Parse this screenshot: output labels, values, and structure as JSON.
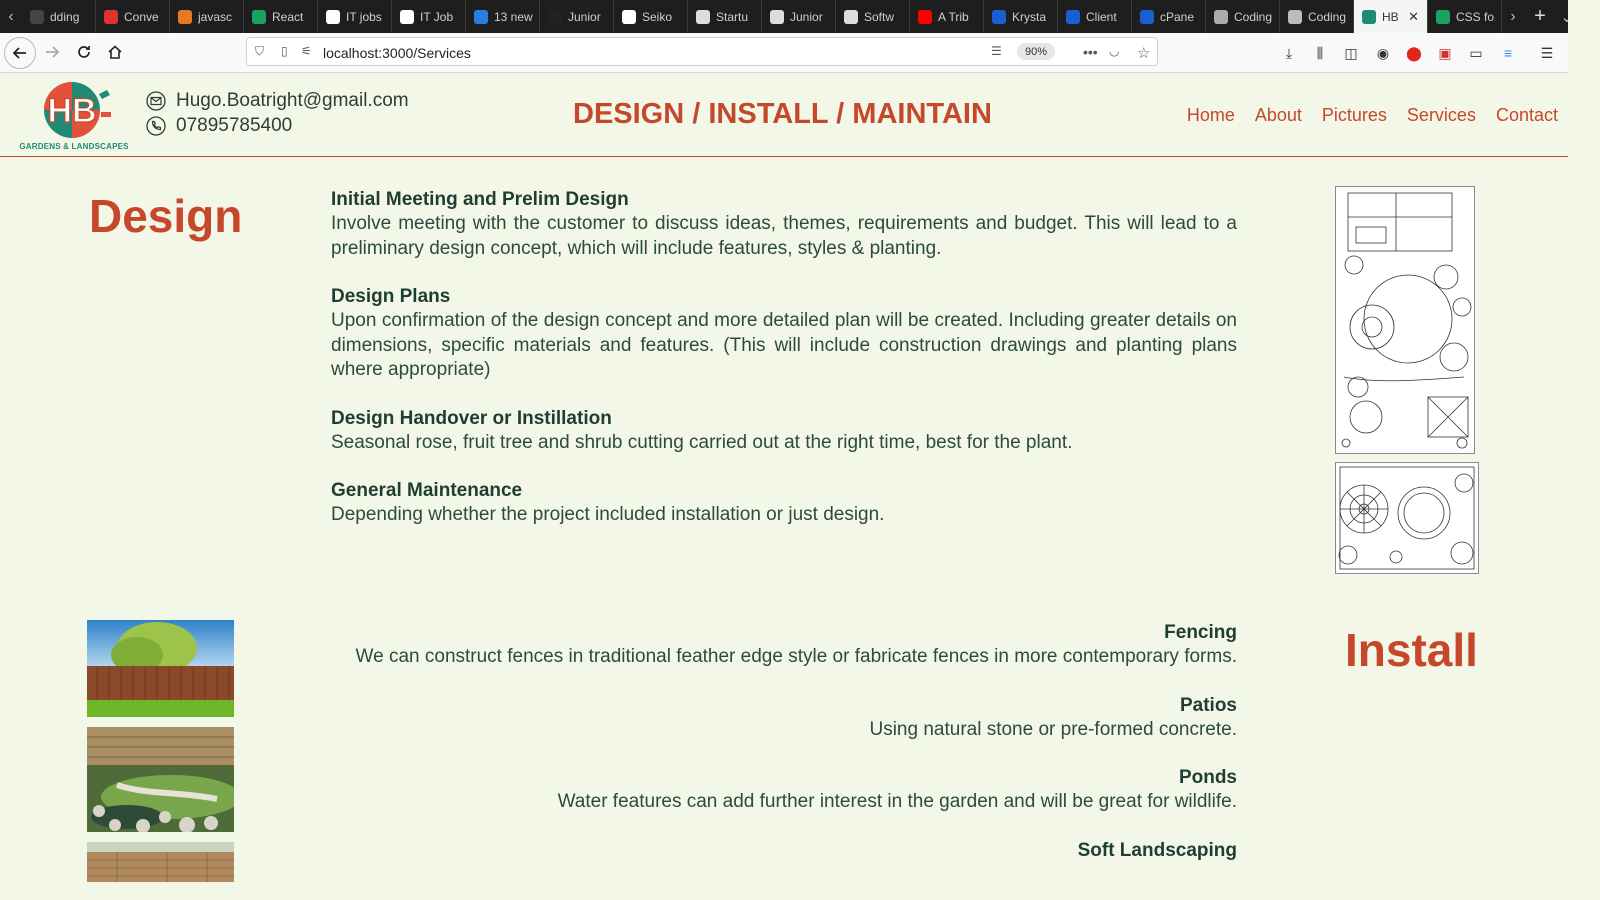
{
  "browser": {
    "tabs": [
      {
        "title": "dding",
        "icon": "tab-page-icon",
        "color": "#444"
      },
      {
        "title": "Conve",
        "icon": "tab-convert-icon",
        "color": "#d33"
      },
      {
        "title": "javasc",
        "icon": "tab-stack-icon",
        "color": "#e87722"
      },
      {
        "title": "React",
        "icon": "tab-w-icon",
        "color": "#1aa260"
      },
      {
        "title": "IT jobs",
        "icon": "tab-job-icon",
        "color": "#ffffff"
      },
      {
        "title": "IT Job",
        "icon": "tab-job2-icon",
        "color": "#ffffff"
      },
      {
        "title": "13 new",
        "icon": "tab-js-icon",
        "color": "#2a7de1"
      },
      {
        "title": "Junior",
        "icon": "tab-d-icon",
        "color": "#222"
      },
      {
        "title": "Seiko",
        "icon": "tab-p-icon",
        "color": "#ffffff"
      },
      {
        "title": "Startu",
        "icon": "tab-w2-icon",
        "color": "#dddddd"
      },
      {
        "title": "Junior",
        "icon": "tab-w3-icon",
        "color": "#dddddd"
      },
      {
        "title": "Softw",
        "icon": "tab-w4-icon",
        "color": "#dddddd"
      },
      {
        "title": "A Trib",
        "icon": "tab-youtube-icon",
        "color": "#ff0000"
      },
      {
        "title": "Krysta",
        "icon": "tab-shield-icon",
        "color": "#1a5fd1"
      },
      {
        "title": "Client",
        "icon": "tab-shield2-icon",
        "color": "#1a5fd1"
      },
      {
        "title": "cPane",
        "icon": "tab-cpanel-icon",
        "color": "#1a5fd1"
      },
      {
        "title": "Coding",
        "icon": "tab-infinity-icon",
        "color": "#aaa"
      },
      {
        "title": "Coding",
        "icon": "tab-news-icon",
        "color": "#bbb"
      },
      {
        "title": "HB",
        "icon": "tab-hb-icon",
        "color": "#1f8a76",
        "active": true
      },
      {
        "title": "CSS fo",
        "icon": "tab-w5-icon",
        "color": "#1aa260"
      }
    ],
    "url": "localhost:3000/Services",
    "zoom": "90%"
  },
  "header": {
    "logo_text": "HB",
    "logo_caption": "GARDENS & LANDSCAPES",
    "email": "Hugo.Boatright@gmail.com",
    "phone": "07895785400",
    "headline": "DESIGN / INSTALL / MAINTAIN",
    "nav": [
      "Home",
      "About",
      "Pictures",
      "Services",
      "Contact"
    ]
  },
  "design": {
    "title": "Design",
    "items": [
      {
        "title": "Initial Meeting and Prelim Design",
        "desc": "Involve meeting with the customer to discuss ideas, themes, requirements and budget. This will lead to a preliminary design concept, which will include features, styles & planting."
      },
      {
        "title": "Design Plans",
        "desc": "Upon confirmation of the design concept and more detailed plan will be created. Including greater details on dimensions, specific materials and features. (This will include construction drawings and planting plans where appropriate)"
      },
      {
        "title": "Design Handover or Instillation",
        "desc": "Seasonal rose, fruit tree and shrub cutting carried out at the right time, best for the plant."
      },
      {
        "title": "General Maintenance",
        "desc": "Depending whether the project included installation or just design."
      }
    ]
  },
  "install": {
    "title": "Install",
    "items": [
      {
        "title": "Fencing",
        "desc": "We can construct fences in traditional feather edge style or fabricate fences in more contemporary forms."
      },
      {
        "title": "Patios",
        "desc": "Using natural stone or pre-formed concrete."
      },
      {
        "title": "Ponds",
        "desc": "Water features can add further interest in the garden and will be great for wildlife."
      },
      {
        "title": "Soft Landscaping",
        "desc": ""
      }
    ]
  },
  "colors": {
    "accent": "#c6482b",
    "teal": "#1f8a76",
    "background": "#f2f7e8",
    "text": "#2c4a3f"
  }
}
